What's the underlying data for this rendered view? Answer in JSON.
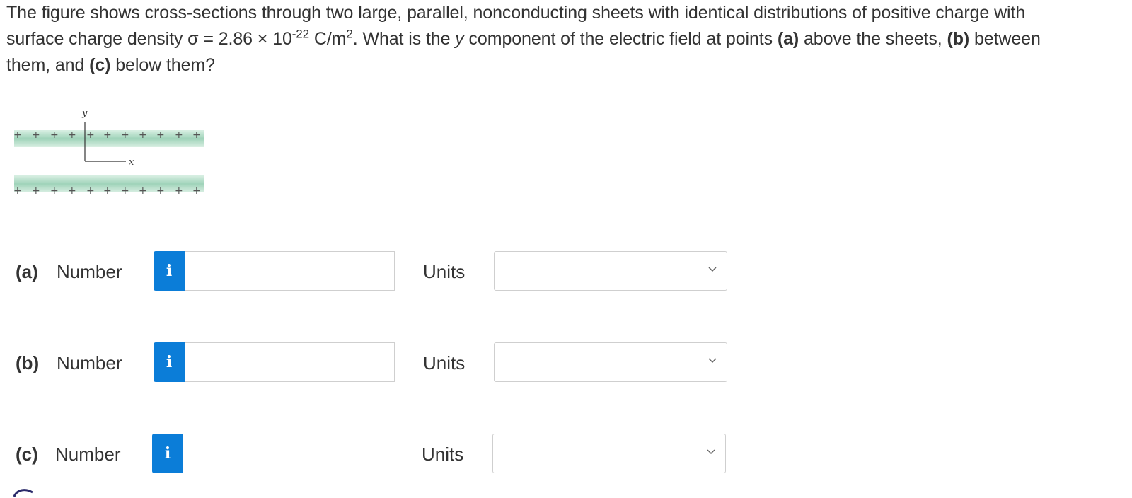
{
  "question": {
    "line1": "The figure shows cross-sections through two large, parallel, nonconducting sheets with identical distributions of positive charge with",
    "line2_a": "surface charge density σ = 2.86 × 10",
    "line2_exp": "-22",
    "line2_b": " C/m",
    "line2_sq": "2",
    "line2_c": ". What is the ",
    "line2_y": "y",
    "line2_d": " component of the electric field at points ",
    "part_a_inline": "(a)",
    "line2_e": " above the sheets, ",
    "part_b_inline": "(b)",
    "line2_f": " between",
    "line3_a": "them, and ",
    "part_c_inline": "(c)",
    "line3_b": " below them?"
  },
  "figure": {
    "y_axis_label": "y",
    "x_axis_label": "x",
    "plus_sign": "+",
    "sheet_color": "#9fd3b9"
  },
  "answers": [
    {
      "part": "(a)",
      "number_label": "Number",
      "info_icon": "i",
      "number_value": "",
      "units_label": "Units",
      "units_value": ""
    },
    {
      "part": "(b)",
      "number_label": "Number",
      "info_icon": "i",
      "number_value": "",
      "units_label": "Units",
      "units_value": ""
    },
    {
      "part": "(c)",
      "number_label": "Number",
      "info_icon": "i",
      "number_value": "",
      "units_label": "Units",
      "units_value": ""
    }
  ],
  "colors": {
    "accent": "#0b7dd8",
    "text": "#333333",
    "border": "#cfcfcf"
  }
}
